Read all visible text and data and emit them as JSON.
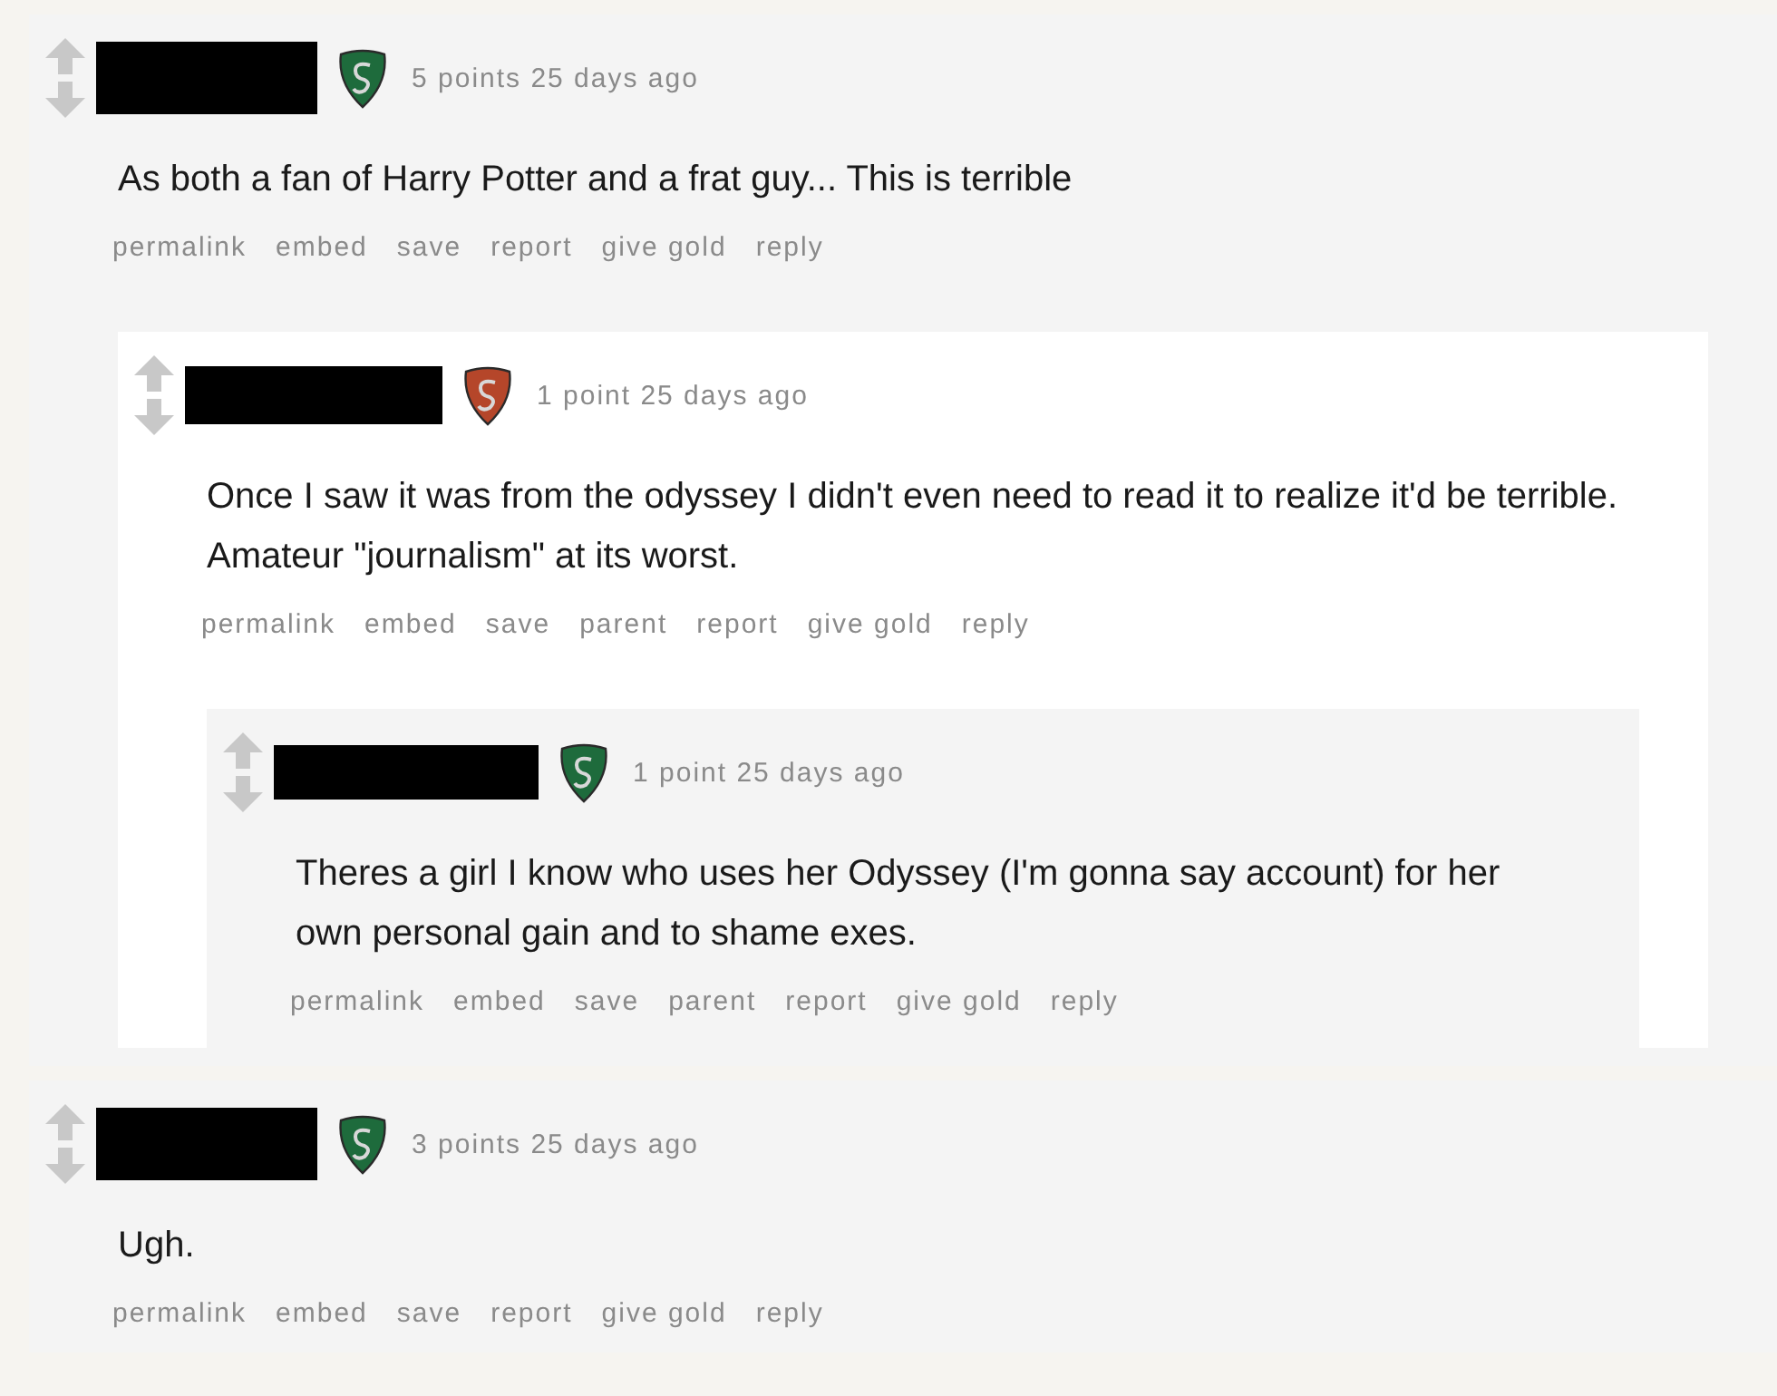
{
  "comments": [
    {
      "flair": {
        "color": "#1e6b3c"
      },
      "score": "5 points",
      "time": "25 days ago",
      "body": "As both a fan of Harry Potter and a frat guy... This is terrible",
      "actions": [
        "permalink",
        "embed",
        "save",
        "report",
        "give gold",
        "reply"
      ],
      "children": [
        {
          "flair": {
            "color": "#b5462a"
          },
          "score": "1 point",
          "time": "25 days ago",
          "body": "Once I saw it was from the odyssey I didn't even need to read it to realize it'd be terrible. Amateur \"journalism\" at its worst.",
          "actions": [
            "permalink",
            "embed",
            "save",
            "parent",
            "report",
            "give gold",
            "reply"
          ],
          "children": [
            {
              "flair": {
                "color": "#1e6b3c"
              },
              "score": "1 point",
              "time": "25 days ago",
              "body": "Theres a girl I know who uses her Odyssey (I'm gonna say account) for her own personal gain and to shame exes.",
              "actions": [
                "permalink",
                "embed",
                "save",
                "parent",
                "report",
                "give gold",
                "reply"
              ]
            }
          ]
        }
      ]
    },
    {
      "flair": {
        "color": "#1e6b3c"
      },
      "score": "3 points",
      "time": "25 days ago",
      "body": "Ugh.",
      "actions": [
        "permalink",
        "embed",
        "save",
        "report",
        "give gold",
        "reply"
      ]
    }
  ]
}
